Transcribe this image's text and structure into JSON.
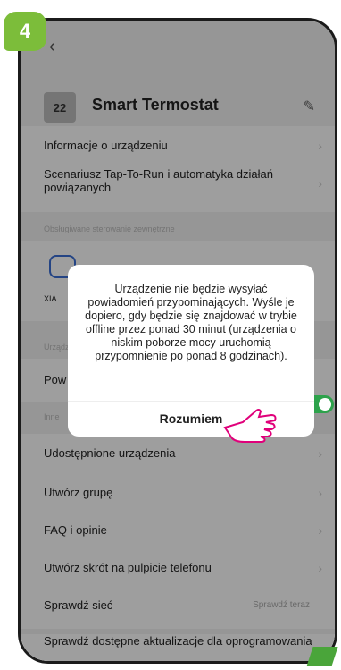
{
  "step_number": "4",
  "header": {
    "back_icon": "‹",
    "device_thumb": "22",
    "title": "Smart Termostat",
    "edit_icon": "✎"
  },
  "rows": {
    "info": "Informacje o urządzeniu",
    "scenario": "Scenariusz Tap-To-Run i automatyka działań powiązanych",
    "section_external": "Obsługiwane sterowanie zewnętrzne",
    "xia_label": "XIA",
    "section_device": "Urządz",
    "pow_label": "Pow",
    "section_other": "Inne",
    "shared": "Udostępnione urządzenia",
    "create_group": "Utwórz grupę",
    "faq": "FAQ i opinie",
    "shortcut": "Utwórz skrót na pulpicie telefonu",
    "check_net": "Sprawdź sieć",
    "check_net_action": "Sprawdź teraz",
    "firmware": "Sprawdź dostępne aktualizacje dla oprogramowania"
  },
  "dialog": {
    "message": "Urządzenie nie będzie wysyłać powiadomień przypominających. Wyśle je dopiero, gdy będzie się znajdować w trybie offline przez ponad 30 minut (urządzenia o niskim poborze mocy uruchomią przypomnienie po ponad 8 godzinach).",
    "button": "Rozumiem"
  },
  "colors": {
    "badge": "#7cbd3a",
    "toggle_on": "#2da24b",
    "annotation": "#e0007a"
  }
}
